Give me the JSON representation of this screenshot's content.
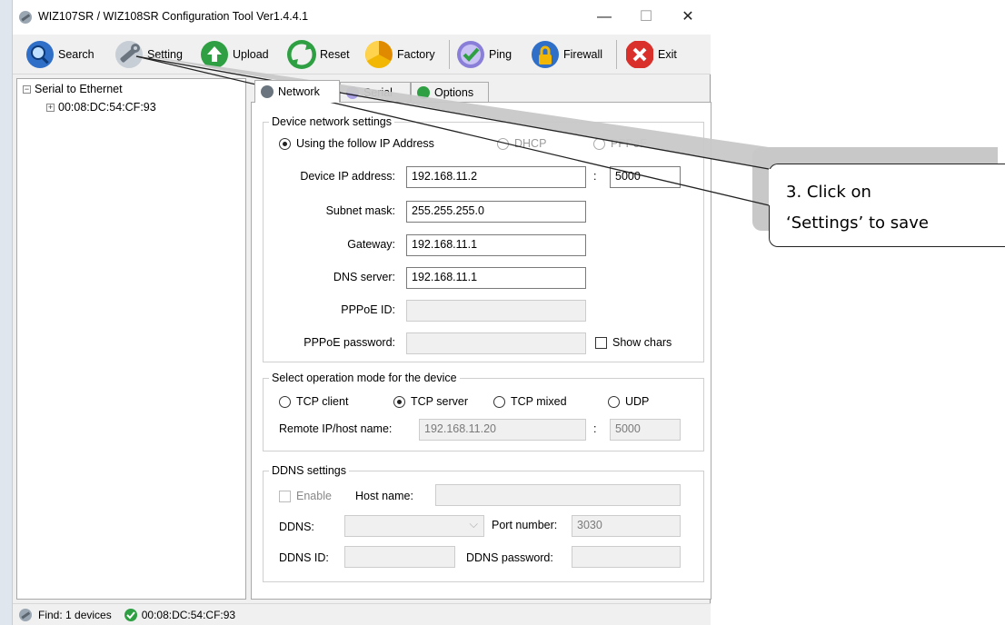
{
  "window": {
    "title": "WIZ107SR / WIZ108SR Configuration Tool Ver1.4.4.1"
  },
  "toolbar": {
    "search": "Search",
    "setting": "Setting",
    "upload": "Upload",
    "reset": "Reset",
    "factory": "Factory",
    "ping": "Ping",
    "firewall": "Firewall",
    "exit": "Exit"
  },
  "tree": {
    "root": "Serial to Ethernet",
    "device": "00:08:DC:54:CF:93"
  },
  "tabs": {
    "network": "Network",
    "serial": "Serial",
    "options": "Options"
  },
  "network": {
    "legend": "Device network settings",
    "radio_static": "Using the follow IP Address",
    "radio_dhcp": "DHCP",
    "radio_pppoe": "PPPoE",
    "ip_label": "Device IP address:",
    "ip_value": "192.168.11.2",
    "port_sep": ":",
    "port_value": "5000",
    "subnet_label": "Subnet mask:",
    "subnet_value": "255.255.255.0",
    "gateway_label": "Gateway:",
    "gateway_value": "192.168.11.1",
    "dns_label": "DNS server:",
    "dns_value": "192.168.11.1",
    "pppoe_id_label": "PPPoE ID:",
    "pppoe_id_value": "",
    "pppoe_pw_label": "PPPoE password:",
    "pppoe_pw_value": "",
    "show_chars": "Show chars"
  },
  "opmode": {
    "legend": "Select operation mode for the device",
    "tcp_client": "TCP client",
    "tcp_server": "TCP server",
    "tcp_mixed": "TCP mixed",
    "udp": "UDP",
    "selected": "TCP server",
    "remote_label": "Remote IP/host name:",
    "remote_value": "192.168.11.20",
    "remote_sep": ":",
    "remote_port": "5000"
  },
  "ddns": {
    "legend": "DDNS settings",
    "enable": "Enable",
    "hostname_label": "Host name:",
    "hostname_value": "",
    "ddns_label": "DDNS:",
    "ddns_value": "",
    "port_label": "Port number:",
    "port_value": "3030",
    "id_label": "DDNS ID:",
    "id_value": "",
    "pw_label": "DDNS password:",
    "pw_value": ""
  },
  "status": {
    "find": "Find: 1 devices",
    "device": "00:08:DC:54:CF:93"
  },
  "callout": {
    "line1": "3. Click on",
    "line2": "‘Settings’ to save"
  },
  "colors": {
    "accent_blue": "#2f6fc7",
    "green": "#2ea043",
    "red": "#d9302c",
    "yellow": "#f2b705"
  },
  "icons": [
    "wrench-icon",
    "search-icon",
    "upload-icon",
    "reset-icon",
    "factory-icon",
    "ping-icon",
    "firewall-icon",
    "exit-icon",
    "minimize-icon",
    "maximize-icon",
    "close-icon",
    "network-icon",
    "serial-icon",
    "options-icon",
    "check-icon"
  ]
}
